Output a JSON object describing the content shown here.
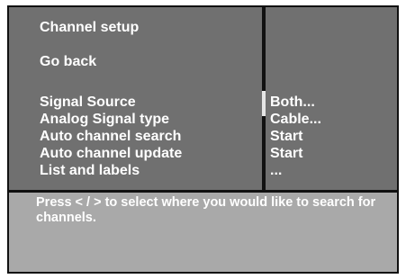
{
  "menu": {
    "title": "Channel setup",
    "back_label": "Go back",
    "items": [
      {
        "label": "Signal Source",
        "value": "Both..."
      },
      {
        "label": "Analog Signal type",
        "value": "Cable..."
      },
      {
        "label": "Auto channel search",
        "value": "Start"
      },
      {
        "label": "Auto channel update",
        "value": "Start"
      },
      {
        "label": "List and labels",
        "value": "..."
      }
    ]
  },
  "help": {
    "text": "Press < / > to select where you would like to search for channels."
  },
  "colors": {
    "menu_background": "#707070",
    "help_background": "#a9a9a9",
    "frame": "#111111",
    "text": "#ffffff"
  }
}
